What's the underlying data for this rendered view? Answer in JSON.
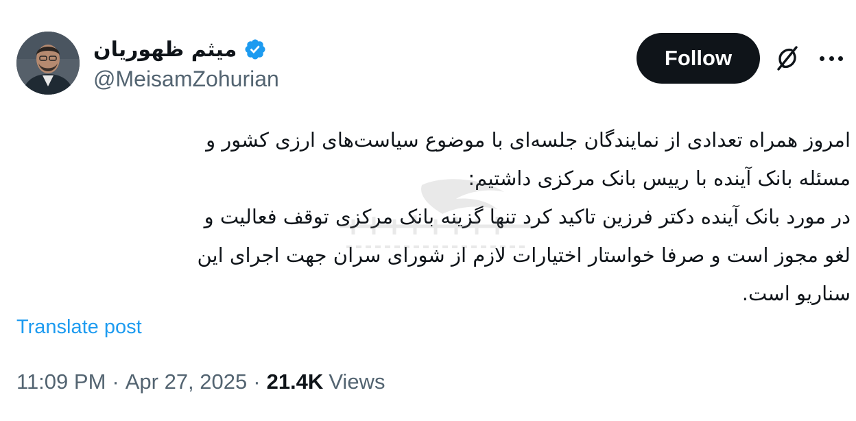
{
  "author": {
    "display_name": "میثم ظهوریان",
    "handle": "@MeisamZohurian",
    "verified_icon": "verified-badge-icon",
    "avatar_icon": "avatar"
  },
  "actions": {
    "follow_label": "Follow",
    "grok_icon": "grok-icon",
    "more_icon": "more-options-icon"
  },
  "post": {
    "lines": [
      "امروز همراه تعدادی از نمایندگان جلسه‌ای با موضوع سیاست‌های ارزی کشور و",
      "مسئله بانک آینده با رییس بانک مرکزی داشتیم:",
      "در مورد بانک آینده دکتر فرزین تاکید کرد تنها گزینه بانک مرکزی توقف فعالیت و",
      "لغو مجوز است و صرفا خواستار اختیارات لازم از شورای سران جهت اجرای این",
      "سناریو است."
    ],
    "watermark_icon": "watermark-logo"
  },
  "translate_label": "Translate post",
  "meta": {
    "time": "11:09 PM",
    "separator": "·",
    "date": "Apr 27, 2025",
    "views_count": "21.4K",
    "views_label": "Views"
  },
  "colors": {
    "text": "#0f1419",
    "secondary": "#536471",
    "link": "#1d9bf0",
    "verified": "#1d9bf0",
    "button_bg": "#0f1419"
  }
}
